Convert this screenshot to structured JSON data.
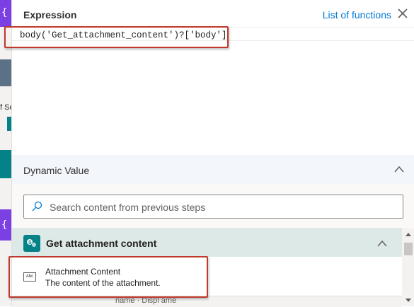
{
  "header": {
    "title": "Expression",
    "list_functions_label": "List of functions"
  },
  "expression": {
    "value": "body('Get_attachment_content')?['body']"
  },
  "dynamic": {
    "title": "Dynamic Value",
    "search_placeholder": "Search content from previous steps"
  },
  "group": {
    "title": "Get attachment content",
    "items": [
      {
        "icon": "abc-text-icon",
        "label": "Attachment Content",
        "description": "The content of the attachment."
      }
    ]
  },
  "background": {
    "left_label": "f Se",
    "bottom_text": "name ·  Displ   ame"
  },
  "colors": {
    "accent": "#0078d4",
    "highlight_border": "#c0392b",
    "group_header": "#dde9e6",
    "sharepoint": "#038387",
    "flow_purple": "#7b3fe4"
  }
}
